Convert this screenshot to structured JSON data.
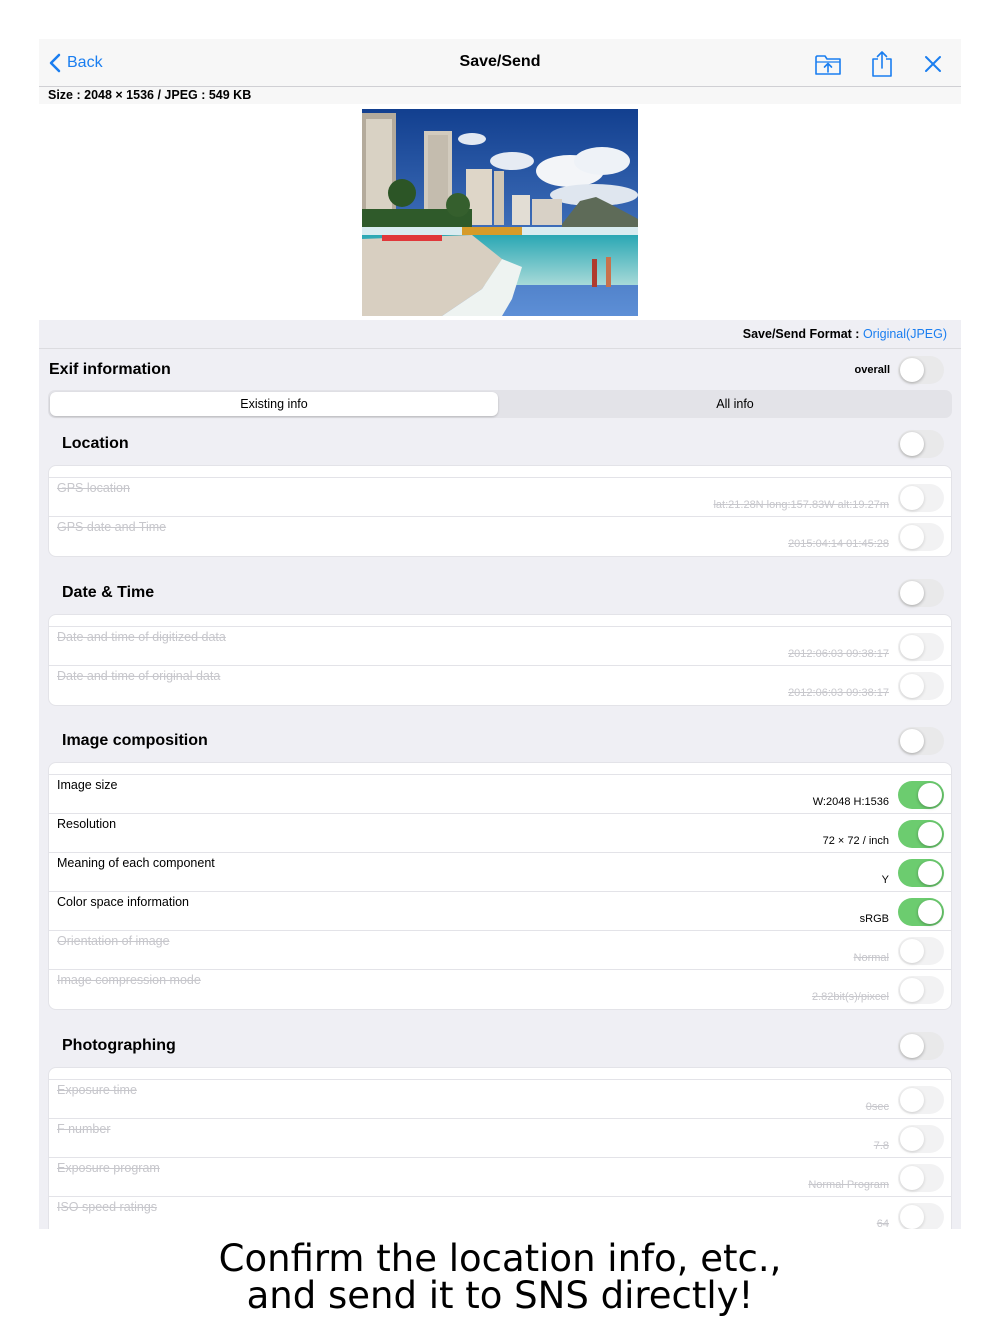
{
  "nav": {
    "back_label": "Back",
    "title": "Save/Send"
  },
  "size_info": "Size : 2048 × 1536 / JPEG : 549 KB",
  "format": {
    "label": "Save/Send Format : ",
    "value": "Original(JPEG)"
  },
  "exif": {
    "title": "Exif information",
    "overall_label": "overall",
    "overall_on": false,
    "segments": [
      "Existing info",
      "All info"
    ],
    "selected_segment": 0
  },
  "sections": [
    {
      "label": "Location",
      "enabled": false,
      "rows": [
        {
          "name": "GPS location",
          "value": "lat:21.28N long:157.83W alt:19.27m",
          "on": false
        },
        {
          "name": "GPS date and Time",
          "value": "2015:04:14 01:45:28",
          "on": false
        }
      ]
    },
    {
      "label": "Date & Time",
      "enabled": false,
      "rows": [
        {
          "name": "Date and time of digitized data",
          "value": "2012:06:03 09:38:17",
          "on": false
        },
        {
          "name": "Date and time of original data",
          "value": "2012:06:03 09:38:17",
          "on": false
        }
      ]
    },
    {
      "label": "Image composition",
      "enabled": false,
      "rows": [
        {
          "name": "Image size",
          "value": "W:2048 H:1536",
          "on": true
        },
        {
          "name": "Resolution",
          "value": "72 × 72 / inch",
          "on": true
        },
        {
          "name": "Meaning of each component",
          "value": "Y",
          "on": true
        },
        {
          "name": "Color space information",
          "value": "sRGB",
          "on": true
        },
        {
          "name": "Orientation of image",
          "value": "Normal",
          "on": false
        },
        {
          "name": "Image compression mode",
          "value": "2.82bit(s)/pixcel",
          "on": false
        }
      ]
    },
    {
      "label": "Photographing",
      "enabled": false,
      "rows": [
        {
          "name": "Exposure time",
          "value": "0sec",
          "on": false
        },
        {
          "name": "F number",
          "value": "7.8",
          "on": false
        },
        {
          "name": "Exposure program",
          "value": "Normal Program",
          "on": false
        },
        {
          "name": "ISO speed ratings",
          "value": "64",
          "on": false
        }
      ]
    }
  ],
  "caption": {
    "line1": "Confirm the location info, etc.,",
    "line2": "and send it to SNS directly!"
  },
  "colors": {
    "accent": "#1a7ef0",
    "toggle_on": "#6ccc6f",
    "background": "#efeff4"
  }
}
